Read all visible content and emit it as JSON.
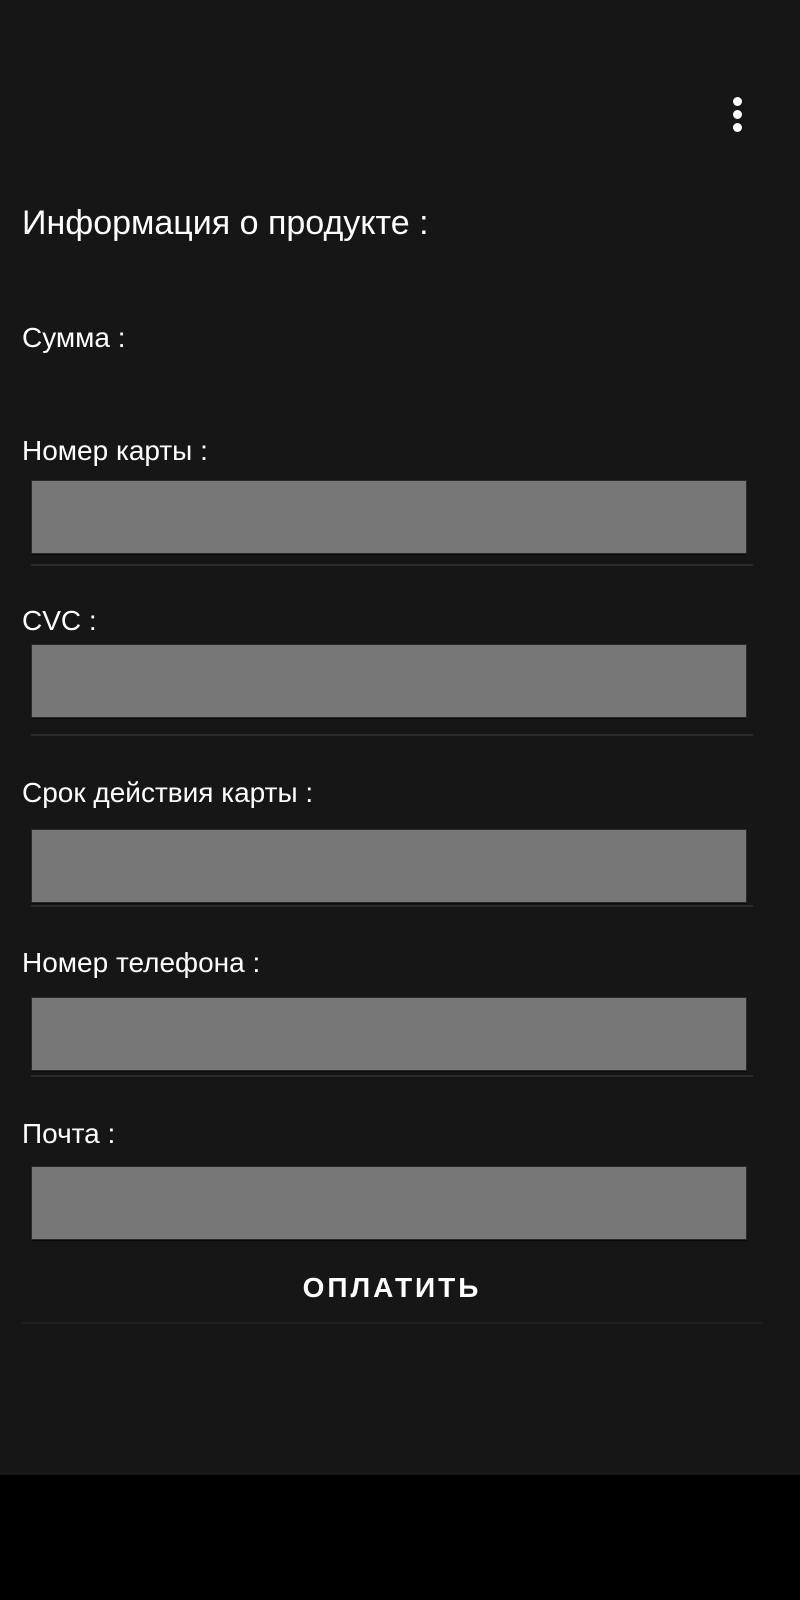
{
  "toolbar": {
    "menu_icon": "more-vert-icon"
  },
  "product": {
    "label": "Информация о продукте :"
  },
  "amount": {
    "label": "Сумма :"
  },
  "form": {
    "card_number_label": "Номер карты :",
    "card_number_value": "",
    "cvc_label": "CVC :",
    "cvc_value": "",
    "expiry_label": "Срок действия карты :",
    "expiry_value": "",
    "phone_label": "Номер телефона :",
    "phone_value": "",
    "email_label": "Почта :",
    "email_value": ""
  },
  "actions": {
    "pay_label": "ОПЛАТИТЬ"
  },
  "colors": {
    "background": "#161616",
    "field_fill": "#777777",
    "text": "#ffffff",
    "nav_bar": "#000000"
  }
}
